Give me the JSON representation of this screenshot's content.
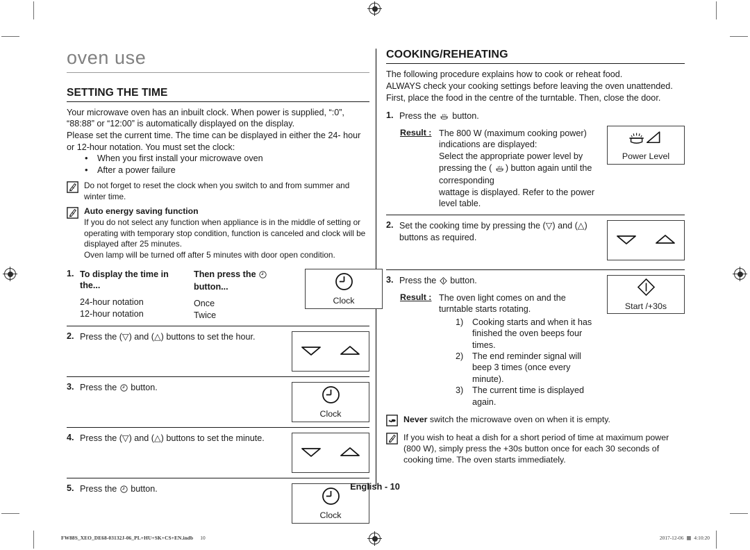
{
  "document": {
    "chapter_title": "oven use",
    "page_label": "English - 10"
  },
  "left_column": {
    "section_title": "SETTING THE TIME",
    "intro_lines": [
      "Your microwave oven has an inbuilt clock. When power is supplied, “:0”,",
      "“88:88” or “12:00” is automatically displayed on the display.",
      "Please set the current time. The time can be displayed in either the 24- hour",
      "or 12-hour notation. You must set the clock:"
    ],
    "bullets": [
      "When you first install your microwave oven",
      "After a power failure"
    ],
    "notes": [
      {
        "icon": "memo-note-icon",
        "heading": "",
        "text": "Do not forget to reset the clock when you switch to and from summer and winter time."
      },
      {
        "icon": "memo-note-icon",
        "heading": "Auto energy saving function",
        "text": "If you do not select any function when appliance is in the middle of setting or operating with temporary stop condition, function is canceled and clock will be displayed after 25 minutes.\nOven lamp will be turned off after 5 minutes with door open condition."
      }
    ],
    "steps": [
      {
        "number": "1.",
        "type": "table",
        "head_a": "To display the time in the...",
        "head_b": "Then press the ⊕ button...",
        "rows": [
          {
            "a": "24-hour notation",
            "b": "Once"
          },
          {
            "a": "12-hour notation",
            "b": "Twice"
          }
        ],
        "key": {
          "icon": "clock-icon",
          "label": "Clock"
        }
      },
      {
        "number": "2.",
        "type": "text",
        "text": "Press the (▽) and (△) buttons to set the hour.",
        "key": {
          "icon": "updown-arrows-icon",
          "label": ""
        }
      },
      {
        "number": "3.",
        "type": "text",
        "text": "Press the ⊕ button.",
        "key": {
          "icon": "clock-icon",
          "label": "Clock"
        }
      },
      {
        "number": "4.",
        "type": "text",
        "text": "Press the (▽) and (△) buttons to set the minute.",
        "key": {
          "icon": "updown-arrows-icon",
          "label": ""
        }
      },
      {
        "number": "5.",
        "type": "text",
        "text": "Press the ⊕ button.",
        "key": {
          "icon": "clock-icon",
          "label": "Clock"
        }
      }
    ]
  },
  "right_column": {
    "section_title": "COOKING/REHEATING",
    "intro_lines": [
      "The following procedure explains how to cook or reheat food.",
      "ALWAYS check your cooking settings before leaving the oven unattended.",
      "First, place the food in the centre of the turntable. Then, close the door."
    ],
    "step1": {
      "number": "1.",
      "text_before": "Press the",
      "text_after": "button.",
      "result_label": "Result :",
      "result_lines": [
        "The 800 W (maximum cooking power)",
        "indications are displayed:",
        "Select the appropriate power level by"
      ],
      "result_line_icon_before": "pressing the (",
      "result_line_icon_after": ") button again until the corresponding",
      "result_last_line": "wattage is displayed. Refer to the power level table.",
      "key": {
        "icon": "power-level-icon",
        "label": "Power Level"
      }
    },
    "step2": {
      "number": "2.",
      "text": "Set the cooking time by pressing the (▽) and (△) buttons as required.",
      "key": {
        "icon": "updown-arrows-icon",
        "label": ""
      }
    },
    "step3": {
      "number": "3.",
      "text_before": "Press the",
      "text_after": "button.",
      "result_label": "Result :",
      "result_lines": [
        "The oven light comes on and the",
        "turntable starts rotating."
      ],
      "sub_items": [
        "Cooking starts and when it has finished the oven beeps four times.",
        "The end reminder signal will beep 3 times (once every minute).",
        "The current time is displayed again."
      ],
      "key": {
        "icon": "start-icon",
        "label": "Start /+30s"
      }
    },
    "notes": [
      {
        "icon": "pointing-hand-icon",
        "bold_lead": "Never",
        "text": " switch the microwave oven on when it is empty."
      },
      {
        "icon": "memo-note-icon",
        "bold_lead": "",
        "text": "If you wish to heat a dish for a short period of time at maximum power (800 W), simply press the +30s button once for each 30 seconds of cooking time. The oven starts immediately."
      }
    ]
  },
  "footer": {
    "left_file": "FW88S_XEO_DE68-03132J-06_PL+HU+SK+CS+EN.indb",
    "left_page": "10",
    "right_date": "2017-12-06",
    "right_time": "4:10:20"
  },
  "colors": {
    "chapter_gray": "#808080",
    "text_black": "#1a1a1a",
    "rule_black": "#1a1a1a",
    "crop_gray": "#6e6e6e"
  }
}
